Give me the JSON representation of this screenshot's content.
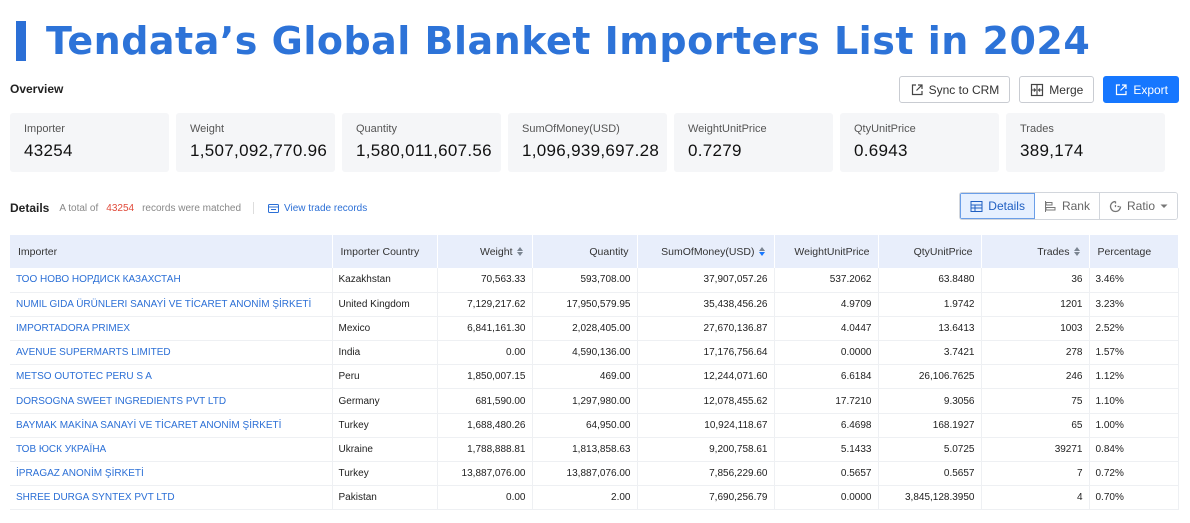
{
  "title": "Tendata’s Global Blanket Importers List in 2024",
  "overview_label": "Overview",
  "toolbar": {
    "sync_label": "Sync to CRM",
    "merge_label": "Merge",
    "export_label": "Export"
  },
  "stats": [
    {
      "label": "Importer",
      "value": "43254"
    },
    {
      "label": "Weight",
      "value": "1,507,092,770.96"
    },
    {
      "label": "Quantity",
      "value": "1,580,011,607.56"
    },
    {
      "label": "SumOfMoney(USD)",
      "value": "1,096,939,697.28"
    },
    {
      "label": "WeightUnitPrice",
      "value": "0.7279"
    },
    {
      "label": "QtyUnitPrice",
      "value": "0.6943"
    },
    {
      "label": "Trades",
      "value": "389,174"
    }
  ],
  "details": {
    "label": "Details",
    "total_prefix": "A total of",
    "count": "43254",
    "total_suffix": "records were matched",
    "view_link": "View trade records",
    "views": {
      "details": "Details",
      "rank": "Rank",
      "ratio": "Ratio"
    }
  },
  "table": {
    "headers": [
      "Importer",
      "Importer Country",
      "Weight",
      "Quantity",
      "SumOfMoney(USD)",
      "WeightUnitPrice",
      "QtyUnitPrice",
      "Trades",
      "Percentage"
    ],
    "rows": [
      [
        "ТОО НОВО НОРДИСК КАЗАХСТАН",
        "Kazakhstan",
        "70,563.33",
        "593,708.00",
        "37,907,057.26",
        "537.2062",
        "63.8480",
        "36",
        "3.46%"
      ],
      [
        "NUMIL GIDA ÜRÜNLERI SANAYİ VE TİCARET ANONİM ŞİRKETİ",
        "United Kingdom",
        "7,129,217.62",
        "17,950,579.95",
        "35,438,456.26",
        "4.9709",
        "1.9742",
        "1201",
        "3.23%"
      ],
      [
        "IMPORTADORA PRIMEX",
        "Mexico",
        "6,841,161.30",
        "2,028,405.00",
        "27,670,136.87",
        "4.0447",
        "13.6413",
        "1003",
        "2.52%"
      ],
      [
        "AVENUE SUPERMARTS LIMITED",
        "India",
        "0.00",
        "4,590,136.00",
        "17,176,756.64",
        "0.0000",
        "3.7421",
        "278",
        "1.57%"
      ],
      [
        "METSO OUTOTEC PERU S A",
        "Peru",
        "1,850,007.15",
        "469.00",
        "12,244,071.60",
        "6.6184",
        "26,106.7625",
        "246",
        "1.12%"
      ],
      [
        "DORSOGNA SWEET INGREDIENTS PVT LTD",
        "Germany",
        "681,590.00",
        "1,297,980.00",
        "12,078,455.62",
        "17.7210",
        "9.3056",
        "75",
        "1.10%"
      ],
      [
        "BAYMAK MAKİNA SANAYİ VE TİCARET ANONİM ŞİRKETİ",
        "Turkey",
        "1,688,480.26",
        "64,950.00",
        "10,924,118.67",
        "6.4698",
        "168.1927",
        "65",
        "1.00%"
      ],
      [
        "ТОВ ЮСК УКРАЇНА",
        "Ukraine",
        "1,788,888.81",
        "1,813,858.63",
        "9,200,758.61",
        "5.1433",
        "5.0725",
        "39271",
        "0.84%"
      ],
      [
        "İPRAGAZ ANONİM ŞİRKETİ",
        "Turkey",
        "13,887,076.00",
        "13,887,076.00",
        "7,856,229.60",
        "0.5657",
        "0.5657",
        "7",
        "0.72%"
      ],
      [
        "SHREE DURGA SYNTEX PVT LTD",
        "Pakistan",
        "0.00",
        "2.00",
        "7,690,256.79",
        "0.0000",
        "3,845,128.3950",
        "4",
        "0.70%"
      ]
    ]
  },
  "colors": {
    "accent": "#1677ff",
    "title": "#2d73d8",
    "header_bg": "#e8eefb",
    "count": "#e04a3a"
  }
}
